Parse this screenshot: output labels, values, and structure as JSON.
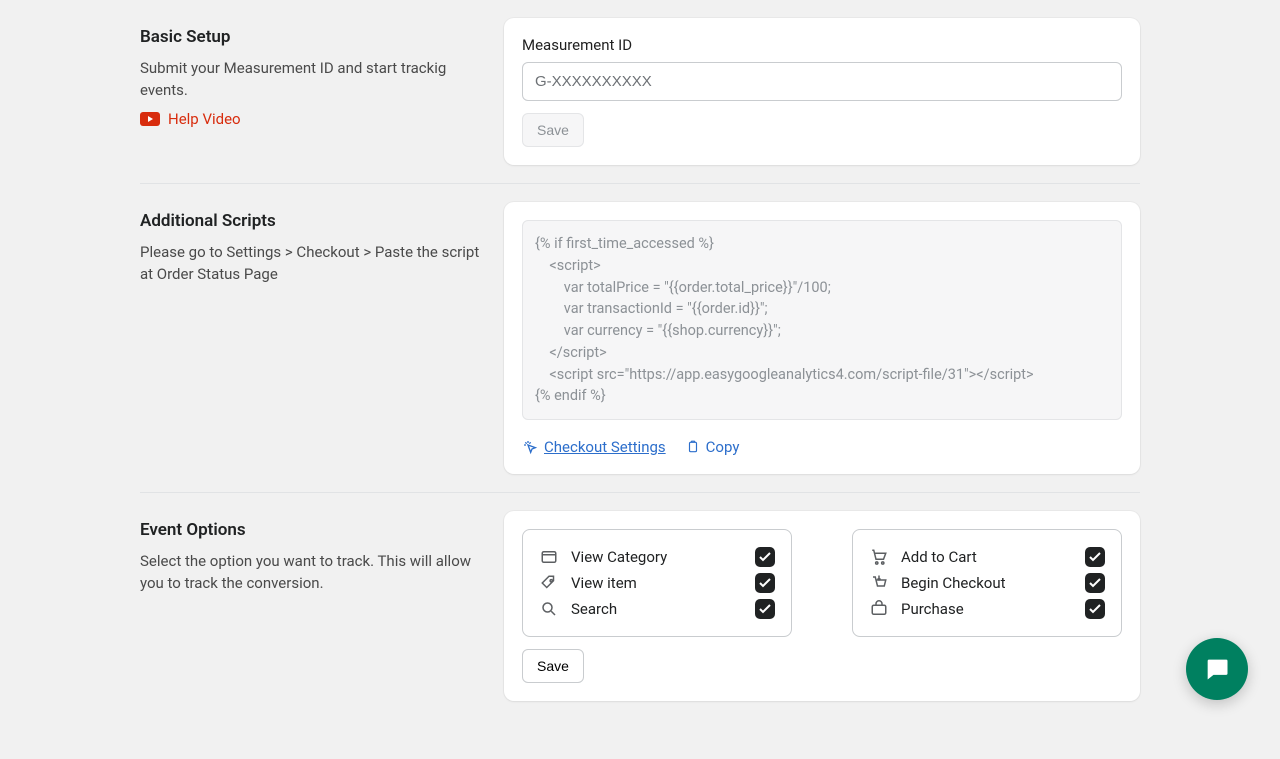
{
  "sections": {
    "basic": {
      "title": "Basic Setup",
      "desc": "Submit your Measurement ID and start trackig events.",
      "help_label": "Help Video",
      "field_label": "Measurement ID",
      "placeholder": "G-XXXXXXXXXX",
      "value": "",
      "save_label": "Save"
    },
    "scripts": {
      "title": "Additional Scripts",
      "desc": "Please go to Settings > Checkout > Paste the script at Order Status Page",
      "code_lines": [
        "{% if first_time_accessed %}",
        "    <script>",
        "        var totalPrice = \"{{order.total_price}}\"/100;",
        "        var transactionId = \"{{order.id}}\";",
        "        var currency = \"{{shop.currency}}\";",
        "    </script>",
        "    <script src=\"https://app.easygoogleanalytics4.com/script-file/31\"></script>",
        "{% endif %}"
      ],
      "checkout_link": "Checkout Settings",
      "copy_label": "Copy"
    },
    "events": {
      "title": "Event Options",
      "desc": "Select the option you want to track. This will allow you to track the conversion.",
      "left": [
        {
          "label": "View Category",
          "checked": true
        },
        {
          "label": "View item",
          "checked": true
        },
        {
          "label": "Search",
          "checked": true
        }
      ],
      "right": [
        {
          "label": "Add to Cart",
          "checked": true
        },
        {
          "label": "Begin Checkout",
          "checked": true
        },
        {
          "label": "Purchase",
          "checked": true
        }
      ],
      "save_label": "Save"
    }
  }
}
